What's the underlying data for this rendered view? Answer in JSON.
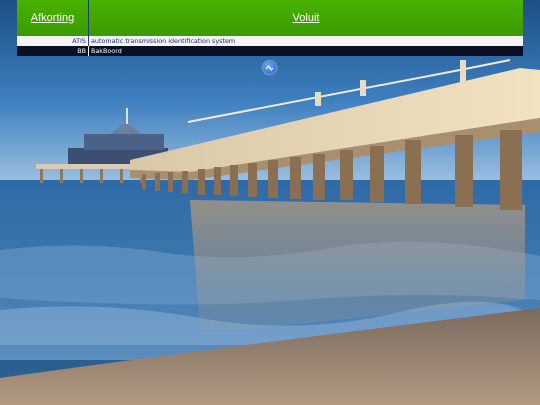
{
  "table": {
    "headers": {
      "abbreviation": "Afkorting",
      "full_form": "Voluit"
    },
    "rows": [
      {
        "abbreviation": "ATIS",
        "full_form": "automatic transmission identification system"
      },
      {
        "abbreviation": "BB",
        "full_form": "BakBoord"
      }
    ]
  },
  "icons": {
    "scroll_button": "chevron-up-down-icon"
  },
  "colors": {
    "header_green": "#48b200",
    "row_dark": "#0b0f24",
    "row_light": "#f4f4f8",
    "link_blue": "#1a2a6e"
  }
}
